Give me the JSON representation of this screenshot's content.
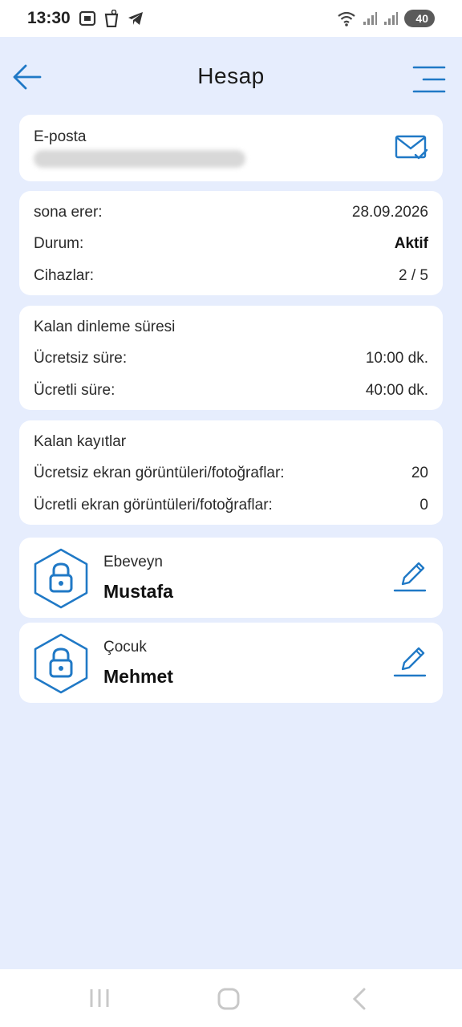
{
  "status_bar": {
    "time": "13:30",
    "battery": "40",
    "icons": [
      "screenshot-icon",
      "delete-icon",
      "telegram-icon",
      "wifi-icon",
      "signal-icon",
      "signal-icon"
    ]
  },
  "header": {
    "title": "Hesap",
    "back_icon": "arrow-left-icon",
    "menu_icon": "menu-icon"
  },
  "email_card": {
    "label": "E-posta",
    "icon": "mail-check-icon"
  },
  "subscription_card": {
    "rows": [
      {
        "label": "sona erer:",
        "value": "28.09.2026"
      },
      {
        "label": "Durum:",
        "value": "Aktif"
      },
      {
        "label": "Cihazlar:",
        "value": "2 / 5"
      }
    ]
  },
  "listening_card": {
    "title": "Kalan dinleme süresi",
    "rows": [
      {
        "label": "Ücretsiz süre:",
        "value": "10:00 dk."
      },
      {
        "label": "Ücretli süre:",
        "value": "40:00 dk."
      }
    ]
  },
  "records_card": {
    "title": "Kalan kayıtlar",
    "rows": [
      {
        "label": "Ücretsiz ekran görüntüleri/fotoğraflar:",
        "value": "20"
      },
      {
        "label": "Ücretli ekran görüntüleri/fotoğraflar:",
        "value": "0"
      }
    ]
  },
  "profiles": [
    {
      "role": "Ebeveyn",
      "name": "Mustafa",
      "icon": "lock-icon",
      "edit_icon": "pencil-icon"
    },
    {
      "role": "Çocuk",
      "name": "Mehmet",
      "icon": "lock-icon",
      "edit_icon": "pencil-icon"
    }
  ],
  "colors": {
    "accent": "#2079c6",
    "background": "#e6edfd",
    "card": "#ffffff"
  }
}
